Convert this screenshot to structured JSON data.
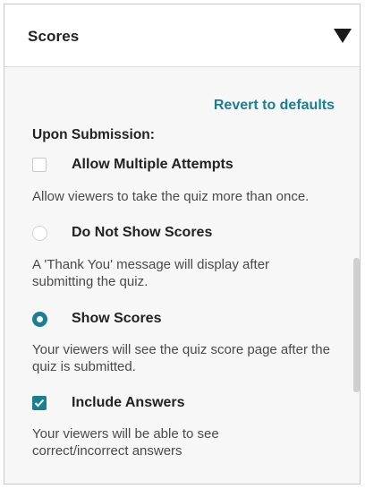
{
  "header": {
    "title": "Scores",
    "toggle_icon": "triangle-down-icon"
  },
  "actions": {
    "revert_label": "Revert to defaults"
  },
  "section": {
    "label": "Upon Submission:"
  },
  "options": {
    "allow_multiple": {
      "label": "Allow Multiple Attempts",
      "checked": false,
      "description": "Allow viewers to take the quiz more than once."
    },
    "do_not_show": {
      "label": "Do Not Show Scores",
      "selected": false,
      "description": "A 'Thank You' message will display after submitting the quiz."
    },
    "show_scores": {
      "label": "Show Scores",
      "selected": true,
      "description": "Your viewers will see the quiz score page after the quiz is submitted."
    },
    "include_answers": {
      "label": "Include Answers",
      "checked": true,
      "description": "Your viewers will be able to see correct/incorrect answers"
    }
  },
  "colors": {
    "accent": "#1b7f94",
    "text": "#222222",
    "muted_text": "#4a4a4a",
    "panel_bg": "#f7f7f7"
  }
}
